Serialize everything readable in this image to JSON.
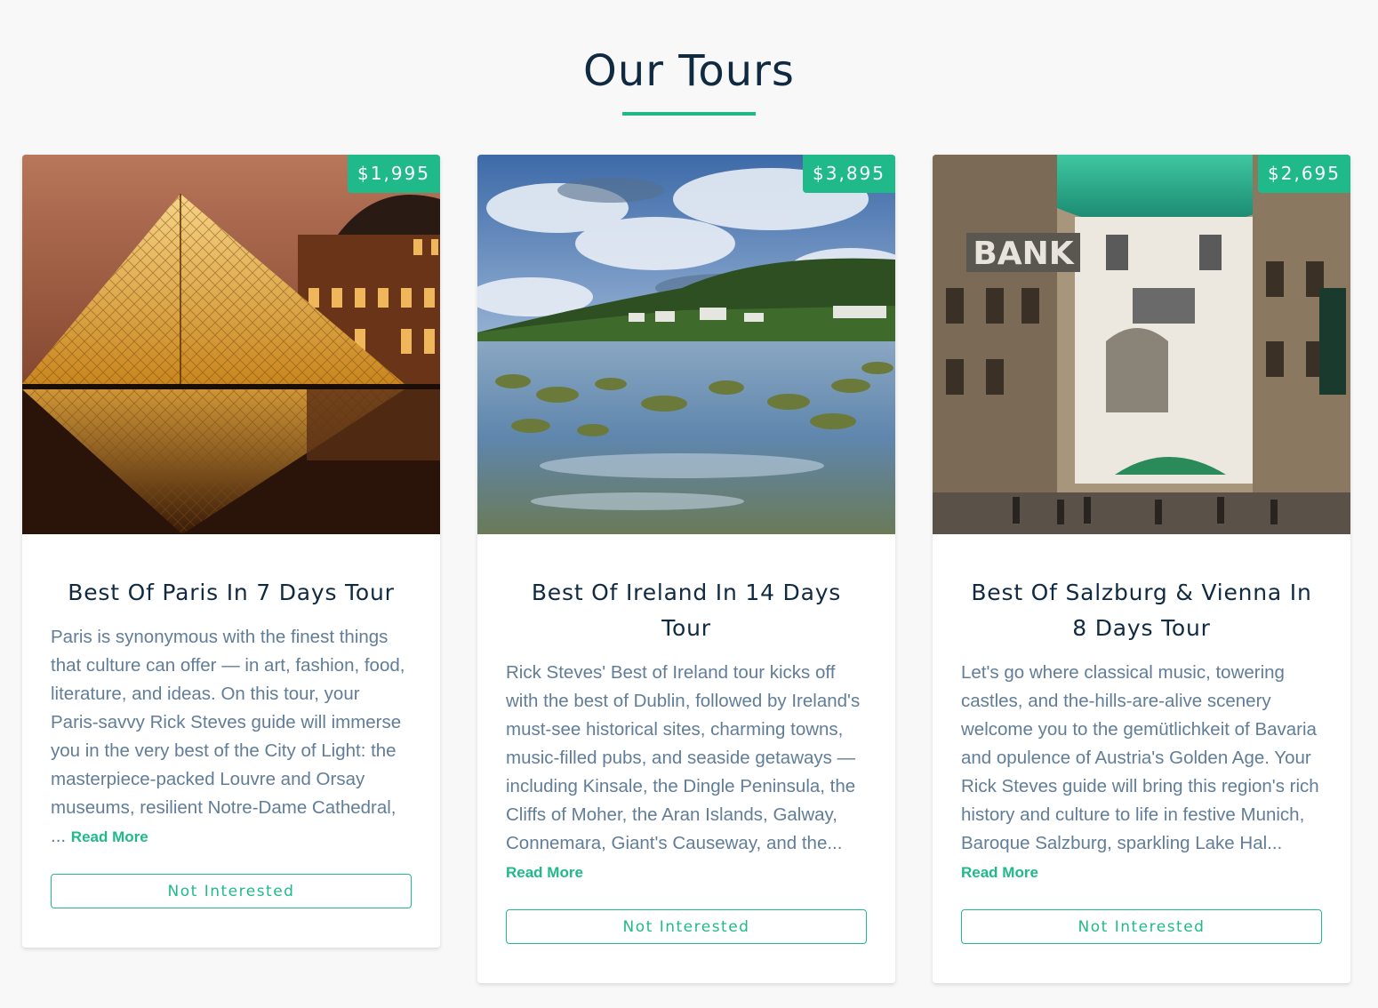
{
  "section": {
    "title": "Our Tours"
  },
  "tours": [
    {
      "price": "$1,995",
      "name": "Best Of Paris In 7 Days Tour",
      "info": "Paris is synonymous with the finest things that culture can offer — in art, fashion, food, literature, and ideas. On this tour, your Paris-savvy Rick Steves guide will immerse you in the very best of the City of Light: the masterpiece-packed Louvre and Orsay museums, resilient Notre-Dame Cathedral, ...",
      "read_more": "Read More",
      "not_interested": "Not Interested",
      "image_alt": "louvre-pyramid-photo"
    },
    {
      "price": "$3,895",
      "name": "Best Of Ireland In 14 Days Tour",
      "info": "Rick Steves' Best of Ireland tour kicks off with the best of Dublin, followed by Ireland's must-see historical sites, charming towns, music-filled pubs, and seaside getaways — including Kinsale, the Dingle Peninsula, the Cliffs of Moher, the Aran Islands, Galway, Connemara, Giant's Causeway, and the...",
      "read_more": "Read More",
      "not_interested": "Not Interested",
      "image_alt": "ireland-coast-photo"
    },
    {
      "price": "$2,695",
      "name": "Best Of Salzburg & Vienna In 8 Days Tour",
      "info": "Let's go where classical music, towering castles, and the-hills-are-alive scenery welcome you to the gemütlichkeit of Bavaria and opulence of Austria's Golden Age. Your Rick Steves guide will bring this region's rich history and culture to life in festive Munich, Baroque Salzburg, sparkling Lake Hal...",
      "read_more": "Read More",
      "not_interested": "Not Interested",
      "image_alt": "vienna-street-photo",
      "sign_text": "BANK"
    }
  ],
  "colors": {
    "accent": "#20b98a",
    "title": "#102a42",
    "body_text": "#617d98",
    "background": "#f8f8f8"
  }
}
